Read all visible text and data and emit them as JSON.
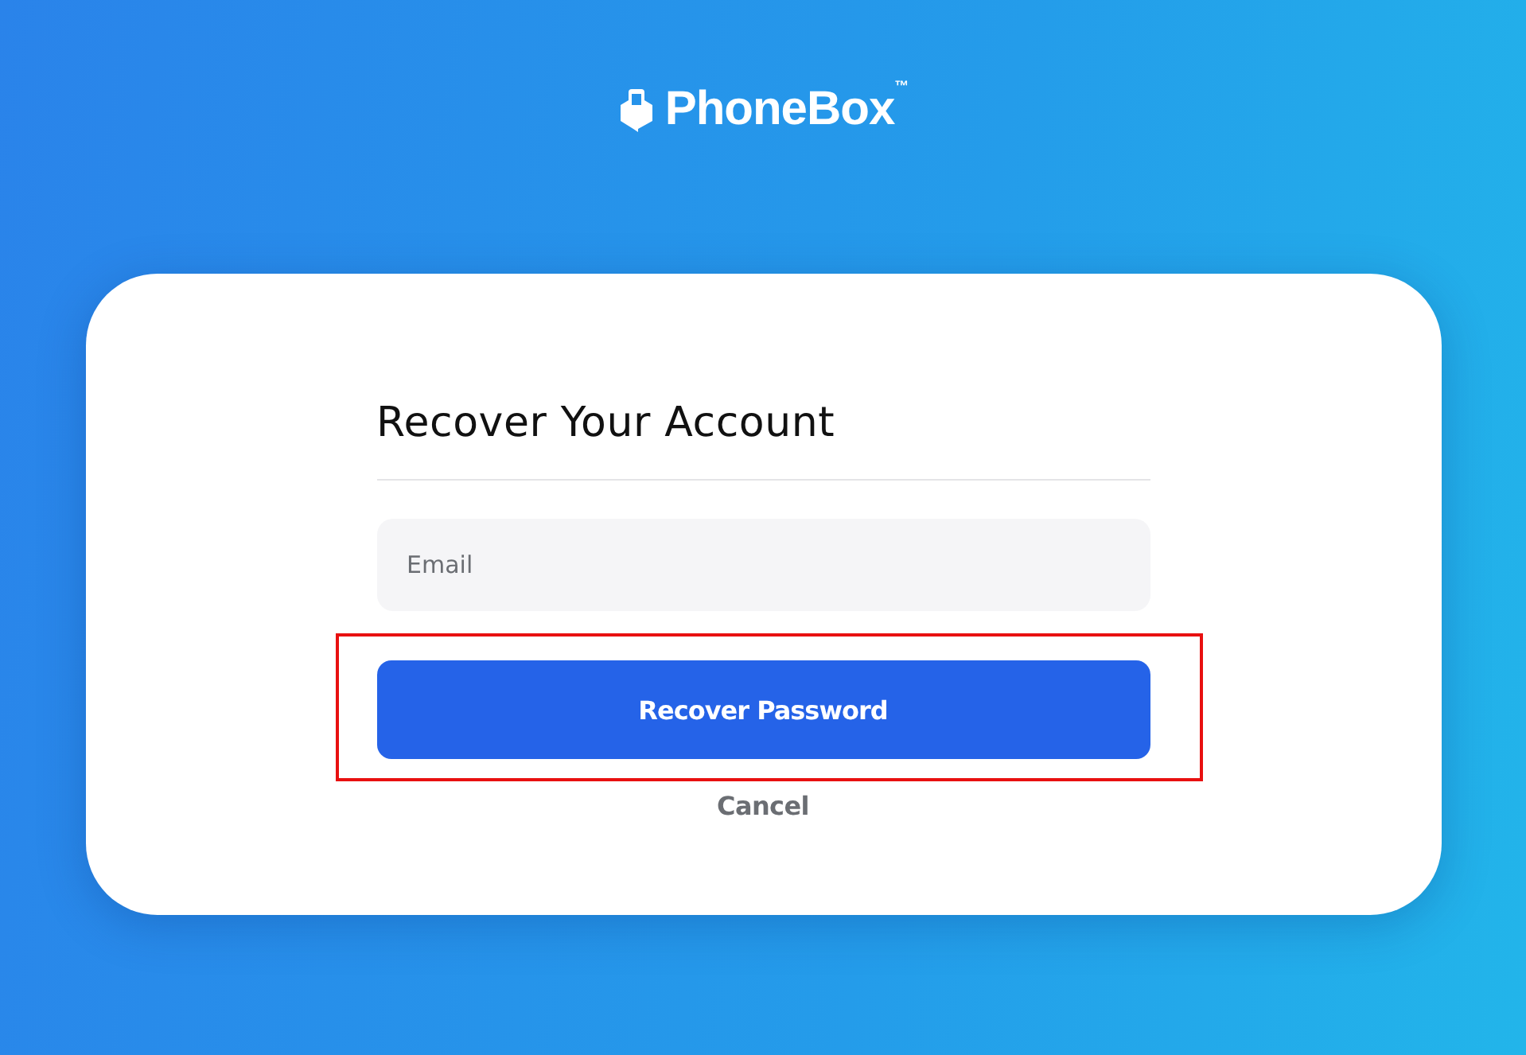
{
  "logo": {
    "name": "PhoneBox",
    "trademark": "™"
  },
  "card": {
    "title": "Recover Your Account",
    "email": {
      "placeholder": "Email"
    },
    "submit": {
      "label": "Recover Password",
      "highlighted": true
    },
    "cancel": {
      "label": "Cancel"
    }
  }
}
